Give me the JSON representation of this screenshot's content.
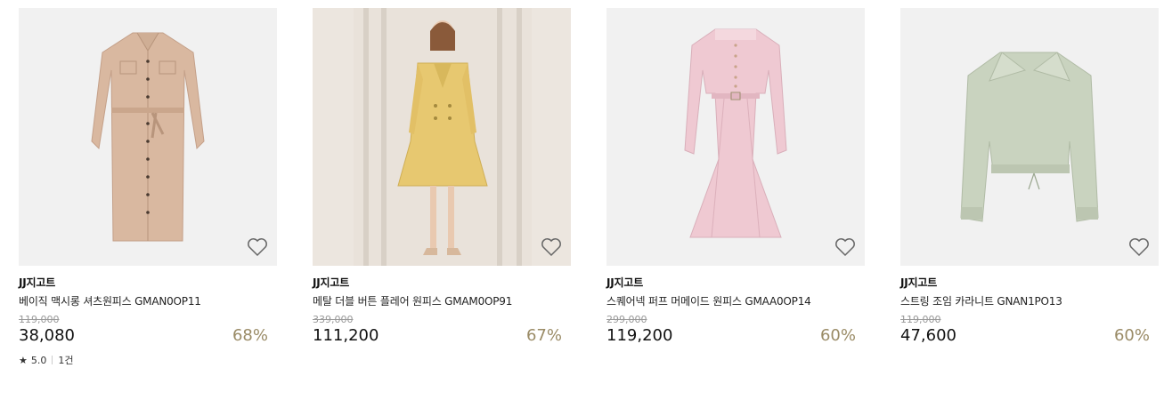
{
  "products": [
    {
      "brand": "JJ지고트",
      "name": "베이직 맥시롱 셔츠원피스 GMAN0OP11",
      "original_price": "119,000",
      "price": "38,080",
      "discount": "68%",
      "rating": "5.0",
      "review_count": "1건",
      "color": "#d9b8a0"
    },
    {
      "brand": "JJ지고트",
      "name": "메탈 더블 버튼 플레어 원피스 GMAM0OP91",
      "original_price": "339,000",
      "price": "111,200",
      "discount": "67%",
      "color": "#e7c870"
    },
    {
      "brand": "JJ지고트",
      "name": "스퀘어넥 퍼프 머메이드 원피스 GMAA0OP14",
      "original_price": "299,000",
      "price": "119,200",
      "discount": "60%",
      "color": "#efc9d2"
    },
    {
      "brand": "JJ지고트",
      "name": "스트링 조임 카라니트 GNAN1PO13",
      "original_price": "119,000",
      "price": "47,600",
      "discount": "60%",
      "color": "#c9d3bf"
    }
  ],
  "icons": {
    "wishlist": "heart-outline-icon",
    "rating": "star-icon"
  },
  "colors": {
    "discount": "#9a8b66",
    "thumb_bg": "#f1f1f1"
  }
}
